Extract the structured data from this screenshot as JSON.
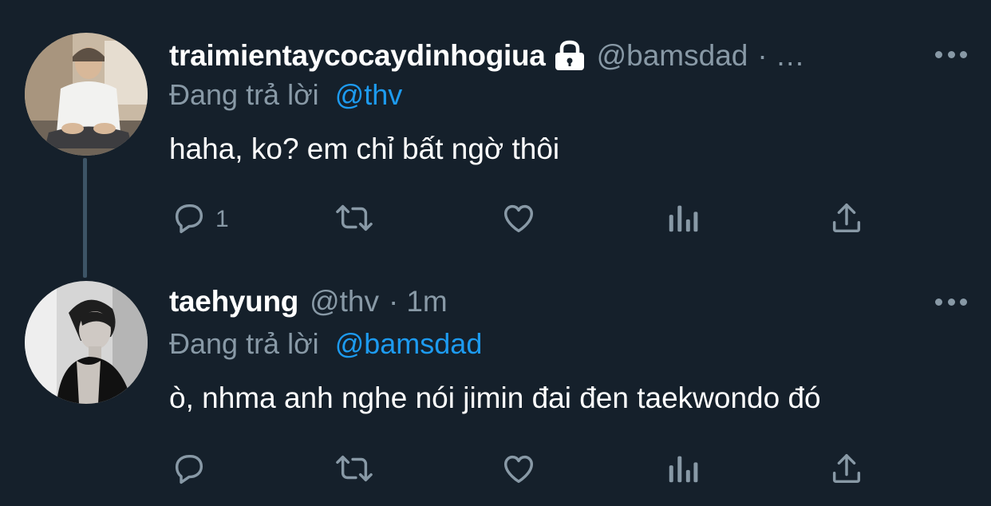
{
  "colors": {
    "background": "#15202b",
    "text_primary": "#ffffff",
    "text_secondary": "#8899a6",
    "mention": "#1d9bf0",
    "thread_line": "#3d5466"
  },
  "tweets": [
    {
      "display_name": "traimientaycocaydinhogiua",
      "protected_icon": "lock-icon",
      "handle": "@bamsdad",
      "separator": "·",
      "time": "…",
      "replying_prefix": "Đang trả lời",
      "replying_to": "@thv",
      "text": "haha, ko? em chỉ bất ngờ thôi",
      "reply_count": "1",
      "icons": [
        "reply-icon",
        "retweet-icon",
        "like-icon",
        "analytics-icon",
        "share-icon"
      ]
    },
    {
      "display_name": "taehyung",
      "handle": "@thv",
      "separator": "·",
      "time": "1m",
      "replying_prefix": "Đang trả lời",
      "replying_to": "@bamsdad",
      "text": "ò, nhma anh nghe nói jimin đai đen taekwondo đó",
      "reply_count": "",
      "icons": [
        "reply-icon",
        "retweet-icon",
        "like-icon",
        "analytics-icon",
        "share-icon"
      ]
    }
  ]
}
